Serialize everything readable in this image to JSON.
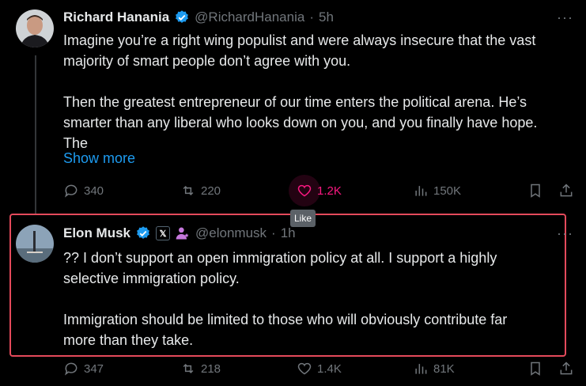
{
  "tweet1": {
    "name": "Richard Hanania",
    "handle": "@RichardHanania",
    "sep": "·",
    "time": "5h",
    "line1": "Imagine you’re a right wing populist and were always insecure that the vast",
    "line2": "majority of smart people don’t agree with you.",
    "line3": "Then the greatest entrepreneur of our time enters the political arena. He’s",
    "line4": "smarter than any liberal who looks down on you, and you finally have hope.",
    "line5": "The",
    "show_more": "Show more",
    "replies": "340",
    "reposts": "220",
    "likes": "1.2K",
    "views": "150K",
    "more": "···"
  },
  "tooltip": "Like",
  "tweet2": {
    "name": "Elon Musk",
    "handle": "@elonmusk",
    "sep": "·",
    "time": "1h",
    "x_badge": "𝕏",
    "line1": "?? I don’t support an open immigration policy at all. I support a highly",
    "line2": "selective immigration policy.",
    "line3": "Immigration should be limited to those who will obviously contribute far",
    "line4": "more than they take.",
    "replies": "347",
    "reposts": "218",
    "likes": "1.4K",
    "views": "81K",
    "more": "···"
  },
  "colors": {
    "verified": "#1d9bf0",
    "like_active": "#f91880",
    "muted": "#71767b",
    "highlight_border": "#e44a5b",
    "affiliate_badge": "#c678dd"
  },
  "icons": [
    "reply-icon",
    "repost-icon",
    "like-icon",
    "views-icon",
    "bookmark-icon",
    "share-icon",
    "verified-icon",
    "more-icon"
  ]
}
